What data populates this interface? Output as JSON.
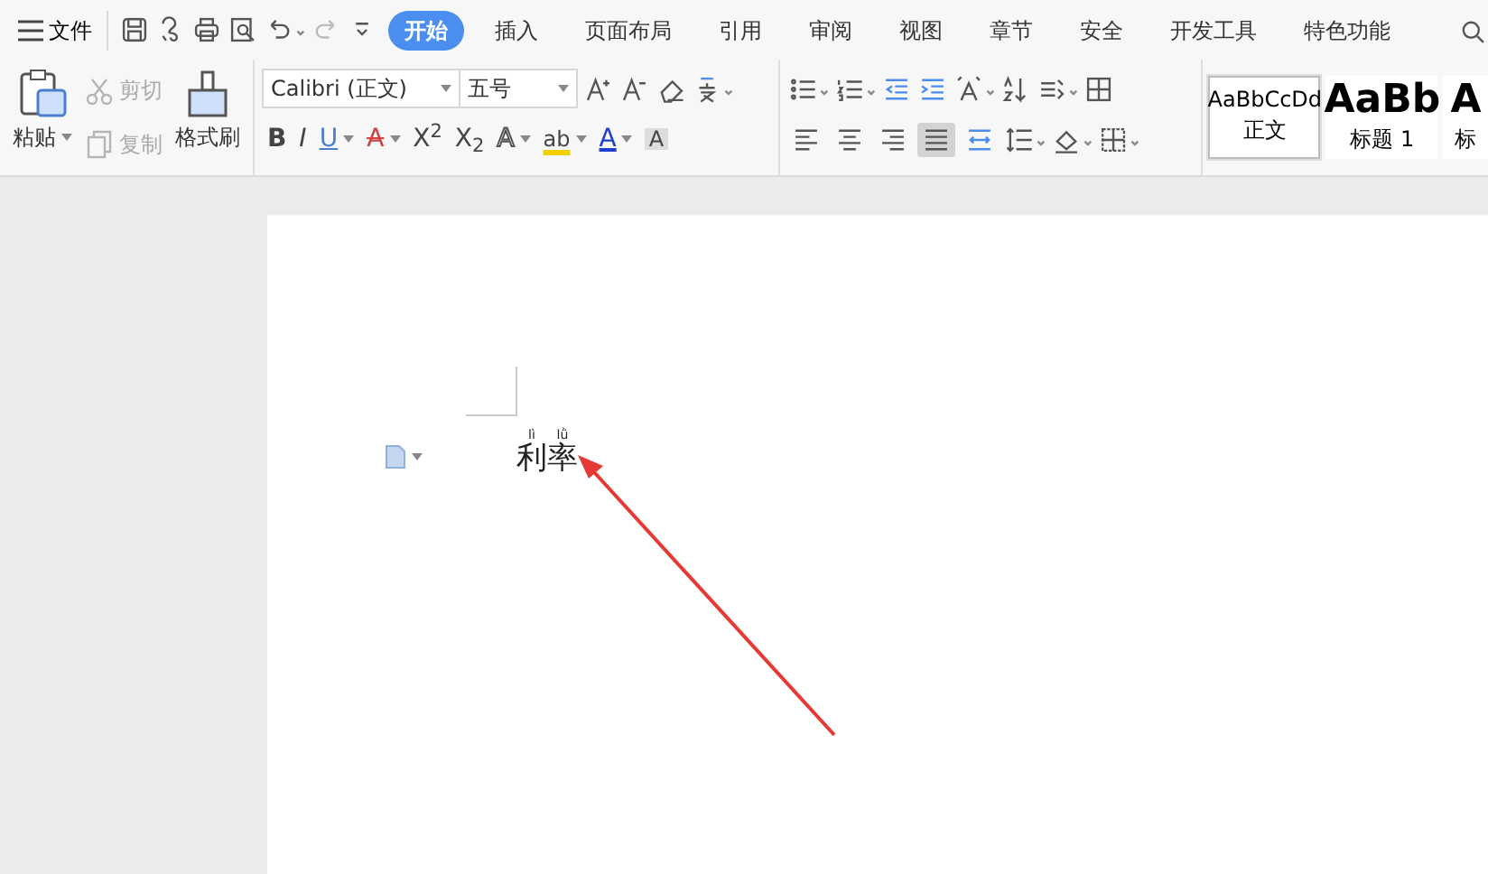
{
  "top_bar": {
    "menu_label": "文件",
    "quick_access": [
      {
        "kind": "save",
        "disabled": false
      },
      {
        "kind": "curl",
        "disabled": false
      },
      {
        "kind": "print",
        "disabled": false
      },
      {
        "kind": "preview",
        "disabled": false
      },
      {
        "kind": "undo",
        "disabled": false
      },
      {
        "kind": "redo",
        "disabled": true
      },
      {
        "kind": "customize",
        "disabled": false
      }
    ],
    "tabs": [
      {
        "label": "开始",
        "selected": true
      },
      {
        "label": "插入",
        "selected": false
      },
      {
        "label": "页面布局",
        "selected": false
      },
      {
        "label": "引用",
        "selected": false
      },
      {
        "label": "审阅",
        "selected": false
      },
      {
        "label": "视图",
        "selected": false
      },
      {
        "label": "章节",
        "selected": false
      },
      {
        "label": "安全",
        "selected": false
      },
      {
        "label": "开发工具",
        "selected": false
      },
      {
        "label": "特色功能",
        "selected": false
      }
    ]
  },
  "clipboard": {
    "paste": "粘贴",
    "cut": {
      "label": "剪切",
      "disabled": true
    },
    "copy": {
      "label": "复制",
      "disabled": true
    },
    "format_painter": "格式刷"
  },
  "font": {
    "family": "Calibri (正文)",
    "size": "五号",
    "format_buttons": [
      {
        "kind": "bold",
        "text": "B",
        "dropdown": false
      },
      {
        "kind": "italic",
        "text": "I",
        "dropdown": false
      },
      {
        "kind": "underline",
        "text": "U",
        "dropdown": true
      },
      {
        "kind": "strike",
        "text": "A",
        "dropdown": true
      },
      {
        "kind": "super",
        "text": "X$^{2}$",
        "dropdown": false
      },
      {
        "kind": "sub",
        "text": "X$_{2}$",
        "dropdown": false
      },
      {
        "kind": "outline",
        "text": "A",
        "dropdown": true
      },
      {
        "kind": "highlight",
        "text": "ab",
        "dropdown": true
      },
      {
        "kind": "font-color",
        "text": "A",
        "dropdown": true
      },
      {
        "kind": "shade",
        "text": "A",
        "dropdown": false
      }
    ]
  },
  "paragraph": {
    "alignment": [
      {
        "kind": "left",
        "selected": false
      },
      {
        "kind": "center",
        "selected": false
      },
      {
        "kind": "right",
        "selected": false
      },
      {
        "kind": "justify",
        "selected": true
      },
      {
        "kind": "distributed",
        "selected": false
      }
    ]
  },
  "styles": [
    {
      "preview": "AaBbCcDd",
      "label": "正文",
      "selected": true
    },
    {
      "preview": "AaBb",
      "label": "标题 1",
      "selected": false
    },
    {
      "preview": "A",
      "label": "标",
      "selected": false
    }
  ],
  "document": {
    "text": [
      {
        "char": "利",
        "pinyin": "lì"
      },
      {
        "char": "率",
        "pinyin": "lǜ"
      }
    ]
  }
}
